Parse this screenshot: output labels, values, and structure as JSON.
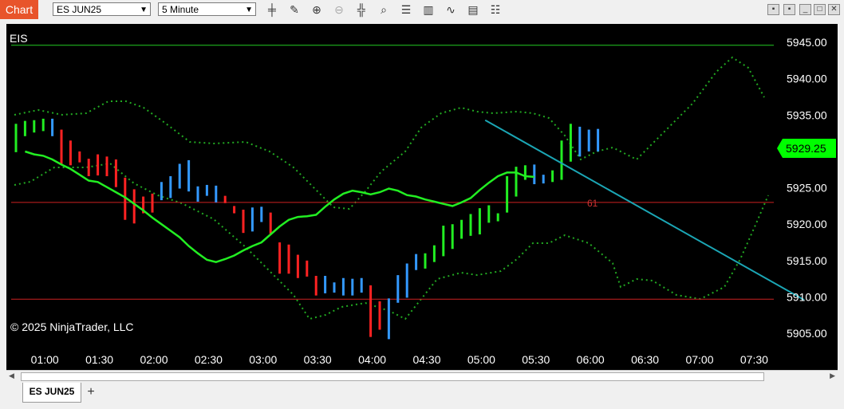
{
  "window": {
    "chart_tab_label": "Chart",
    "instrument_select": "ES JUN25",
    "interval_select": "5 Minute",
    "toolbar_icons": [
      "bar-type-icon",
      "pencil-icon",
      "zoom-in-icon",
      "zoom-out-icon",
      "crosshair-icon",
      "data-box-icon",
      "properties-icon",
      "indicators-icon",
      "strategies-icon",
      "templates-icon",
      "window-icon"
    ],
    "bottom_tab_label": "ES JUN25",
    "add_tab_label": "+"
  },
  "chart_data": {
    "type": "candlestick",
    "instrument_label": "EIS",
    "copyright": "© 2025 NinjaTrader, LLC",
    "price_label": "5929.25",
    "price_label_color": "#00ff00",
    "annotation": "61",
    "ylim": [
      5902.6,
      5947.2
    ],
    "y_ticks": [
      "5945.00",
      "5940.00",
      "5935.00",
      "5930.00",
      "5925.00",
      "5920.00",
      "5915.00",
      "5910.00",
      "5905.00"
    ],
    "x_ticks": [
      {
        "label": "01:00",
        "bar": 3
      },
      {
        "label": "01:30",
        "bar": 9
      },
      {
        "label": "02:00",
        "bar": 15
      },
      {
        "label": "02:30",
        "bar": 21
      },
      {
        "label": "03:00",
        "bar": 27
      },
      {
        "label": "03:30",
        "bar": 33
      },
      {
        "label": "04:00",
        "bar": 39
      },
      {
        "label": "04:30",
        "bar": 45
      },
      {
        "label": "05:00",
        "bar": 51
      },
      {
        "label": "05:30",
        "bar": 57
      },
      {
        "label": "06:00",
        "bar": 63
      },
      {
        "label": "06:30",
        "bar": 69
      },
      {
        "label": "07:00",
        "bar": 75
      },
      {
        "label": "07:30",
        "bar": 81
      }
    ],
    "colors": {
      "up": "#3399ff",
      "down": "#ff2222",
      "strong_up": "#22ee22",
      "sma": "#22ee22",
      "bands": "#22aa22",
      "trendline": "#1ba6b5",
      "support": "#cc2222",
      "resistance": "#22cc22",
      "text": "#ffffff"
    },
    "bars": [
      {
        "h": 5933.8,
        "l": 5929.9,
        "c": "g"
      },
      {
        "h": 5934.2,
        "l": 5932.1,
        "c": "g"
      },
      {
        "h": 5934.3,
        "l": 5932.6,
        "c": "g"
      },
      {
        "h": 5934.5,
        "l": 5932.8,
        "c": "g"
      },
      {
        "h": 5934.5,
        "l": 5932.1,
        "c": "b"
      },
      {
        "h": 5933.0,
        "l": 5928.3,
        "c": "r"
      },
      {
        "h": 5931.5,
        "l": 5928.1,
        "c": "r"
      },
      {
        "h": 5930.0,
        "l": 5928.5,
        "c": "r"
      },
      {
        "h": 5929.0,
        "l": 5926.6,
        "c": "r"
      },
      {
        "h": 5929.6,
        "l": 5926.7,
        "c": "r"
      },
      {
        "h": 5929.3,
        "l": 5926.6,
        "c": "r"
      },
      {
        "h": 5928.9,
        "l": 5925.1,
        "c": "r"
      },
      {
        "h": 5926.4,
        "l": 5920.6,
        "c": "r"
      },
      {
        "h": 5924.8,
        "l": 5920.1,
        "c": "r"
      },
      {
        "h": 5923.8,
        "l": 5921.5,
        "c": "r"
      },
      {
        "h": 5924.2,
        "l": 5921.6,
        "c": "r"
      },
      {
        "h": 5925.8,
        "l": 5923.3,
        "c": "b"
      },
      {
        "h": 5926.6,
        "l": 5923.6,
        "c": "b"
      },
      {
        "h": 5928.3,
        "l": 5924.9,
        "c": "b"
      },
      {
        "h": 5928.8,
        "l": 5924.5,
        "c": "b"
      },
      {
        "h": 5925.2,
        "l": 5923.1,
        "c": "b"
      },
      {
        "h": 5925.4,
        "l": 5923.9,
        "c": "b"
      },
      {
        "h": 5925.3,
        "l": 5923.0,
        "c": "b"
      },
      {
        "h": 5923.9,
        "l": 5922.9,
        "c": "r"
      },
      {
        "h": 5922.5,
        "l": 5921.5,
        "c": "r"
      },
      {
        "h": 5922.0,
        "l": 5918.8,
        "c": "r"
      },
      {
        "h": 5922.3,
        "l": 5919.0,
        "c": "b"
      },
      {
        "h": 5922.4,
        "l": 5920.3,
        "c": "b"
      },
      {
        "h": 5921.6,
        "l": 5918.7,
        "c": "r"
      },
      {
        "h": 5917.5,
        "l": 5913.2,
        "c": "r"
      },
      {
        "h": 5917.2,
        "l": 5913.2,
        "c": "r"
      },
      {
        "h": 5915.8,
        "l": 5912.6,
        "c": "r"
      },
      {
        "h": 5915.0,
        "l": 5912.8,
        "c": "r"
      },
      {
        "h": 5912.9,
        "l": 5910.2,
        "c": "r"
      },
      {
        "h": 5912.9,
        "l": 5910.5,
        "c": "b"
      },
      {
        "h": 5912.0,
        "l": 5910.6,
        "c": "b"
      },
      {
        "h": 5912.6,
        "l": 5910.2,
        "c": "b"
      },
      {
        "h": 5912.5,
        "l": 5910.2,
        "c": "b"
      },
      {
        "h": 5912.6,
        "l": 5910.6,
        "c": "b"
      },
      {
        "h": 5911.6,
        "l": 5904.5,
        "c": "r"
      },
      {
        "h": 5909.4,
        "l": 5905.5,
        "c": "r"
      },
      {
        "h": 5909.8,
        "l": 5904.2,
        "c": "b"
      },
      {
        "h": 5913.0,
        "l": 5909.2,
        "c": "b"
      },
      {
        "h": 5914.6,
        "l": 5909.9,
        "c": "b"
      },
      {
        "h": 5915.9,
        "l": 5913.7,
        "c": "b"
      },
      {
        "h": 5916.0,
        "l": 5913.9,
        "c": "g"
      },
      {
        "h": 5917.1,
        "l": 5914.8,
        "c": "g"
      },
      {
        "h": 5919.8,
        "l": 5915.6,
        "c": "g"
      },
      {
        "h": 5920.0,
        "l": 5916.6,
        "c": "g"
      },
      {
        "h": 5920.6,
        "l": 5918.0,
        "c": "g"
      },
      {
        "h": 5921.4,
        "l": 5918.4,
        "c": "g"
      },
      {
        "h": 5922.2,
        "l": 5918.6,
        "c": "g"
      },
      {
        "h": 5922.6,
        "l": 5920.2,
        "c": "g"
      },
      {
        "h": 5921.5,
        "l": 5920.4,
        "c": "g"
      },
      {
        "h": 5926.6,
        "l": 5921.6,
        "c": "g"
      },
      {
        "h": 5927.9,
        "l": 5923.8,
        "c": "g"
      },
      {
        "h": 5928.1,
        "l": 5926.1,
        "c": "g"
      },
      {
        "h": 5928.2,
        "l": 5925.5,
        "c": "b"
      },
      {
        "h": 5926.8,
        "l": 5925.6,
        "c": "b"
      },
      {
        "h": 5927.4,
        "l": 5925.8,
        "c": "g"
      },
      {
        "h": 5931.5,
        "l": 5926.1,
        "c": "g"
      },
      {
        "h": 5933.8,
        "l": 5928.6,
        "c": "g"
      },
      {
        "h": 5933.4,
        "l": 5929.3,
        "c": "b"
      },
      {
        "h": 5933.0,
        "l": 5930.0,
        "c": "b"
      },
      {
        "h": 5933.1,
        "l": 5930.0,
        "c": "b"
      }
    ],
    "sma": [
      5930.0,
      5929.6,
      5929.4,
      5928.9,
      5928.2,
      5927.6,
      5926.8,
      5926.0,
      5925.8,
      5925.1,
      5924.4,
      5923.7,
      5922.8,
      5921.9,
      5920.9,
      5920.0,
      5919.1,
      5918.2,
      5917.0,
      5916.0,
      5915.1,
      5914.8,
      5915.2,
      5915.7,
      5916.4,
      5917.0,
      5917.5,
      5918.6,
      5919.7,
      5920.6,
      5921.0,
      5921.1,
      5921.3,
      5922.4,
      5923.4,
      5924.2,
      5924.6,
      5924.4,
      5924.1,
      5924.4,
      5924.9,
      5924.6,
      5924.0,
      5923.8,
      5923.4,
      5923.1,
      5922.8,
      5922.5,
      5923.0,
      5923.6,
      5924.7,
      5925.7,
      5926.6,
      5927.1,
      5927.1,
      5926.6,
      5926.5
    ],
    "trendline": {
      "from": [
        51.6,
        5934.3
      ],
      "to": [
        87.4,
        5909.6
      ]
    },
    "support_lines": [
      5909.7,
      5923.0
    ],
    "resistance_line": 5944.6
  }
}
